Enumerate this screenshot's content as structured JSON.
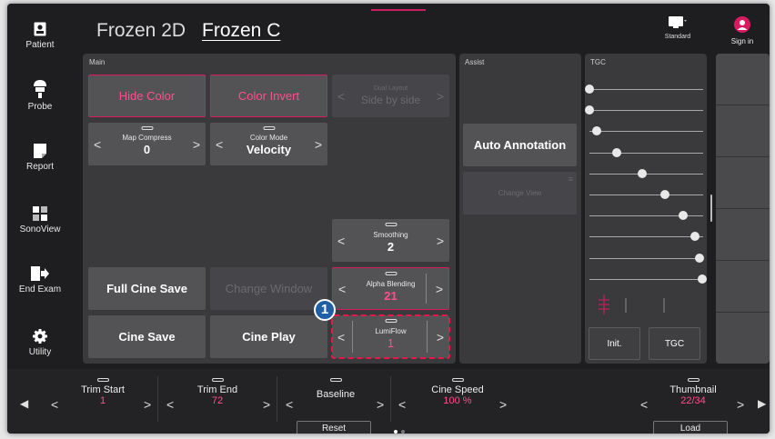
{
  "rail": [
    {
      "label": "Patient",
      "icon": "patient-icon"
    },
    {
      "label": "Probe",
      "icon": "probe-icon"
    },
    {
      "label": "Report",
      "icon": "report-icon"
    },
    {
      "label": "SonoView",
      "icon": "sonoview-icon"
    },
    {
      "label": "End Exam",
      "icon": "end-exam-icon"
    },
    {
      "label": "Utility",
      "icon": "utility-icon"
    }
  ],
  "header": {
    "tab1": "Frozen 2D",
    "tab2": "Frozen C",
    "standard_label": "Standard",
    "signin_label": "Sign in"
  },
  "main": {
    "label": "Main",
    "hide_color": "Hide Color",
    "color_invert": "Color Invert",
    "dual_layout": {
      "caption": "Dual Layout",
      "value": "Side by side"
    },
    "map_compress": {
      "caption": "Map Compress",
      "value": "0"
    },
    "color_mode": {
      "caption": "Color Mode",
      "value": "Velocity"
    },
    "smoothing": {
      "caption": "Smoothing",
      "value": "2"
    },
    "full_cine_save": "Full Cine Save",
    "change_window": "Change Window",
    "alpha_blending": {
      "caption": "Alpha Blending",
      "value": "21"
    },
    "cine_save": "Cine Save",
    "cine_play": "Cine Play",
    "lumiflow": {
      "caption": "LumiFlow",
      "value": "1"
    },
    "callout_number": "1"
  },
  "assist": {
    "label": "Assist",
    "auto_annotation": "Auto Annotation",
    "change_view": "Change View"
  },
  "tgc": {
    "label": "TGC",
    "init_label": "Init.",
    "tgc_button": "TGC",
    "slider_levels": [
      0.0,
      0.0,
      0.06,
      0.24,
      0.46,
      0.66,
      0.82,
      0.93,
      0.97,
      0.99
    ]
  },
  "bottom": {
    "trim_start": {
      "caption": "Trim Start",
      "value": "1"
    },
    "trim_end": {
      "caption": "Trim End",
      "value": "72"
    },
    "baseline": {
      "caption": "Baseline",
      "button": "Reset"
    },
    "cine_speed": {
      "caption": "Cine Speed",
      "value": "100 %"
    },
    "thumbnail": {
      "caption": "Thumbnail",
      "value": "22/34",
      "button": "Load"
    }
  },
  "colors": {
    "accent": "#d81b60",
    "accent_text": "#ff4f8b",
    "callout": "#1f5fa8"
  }
}
